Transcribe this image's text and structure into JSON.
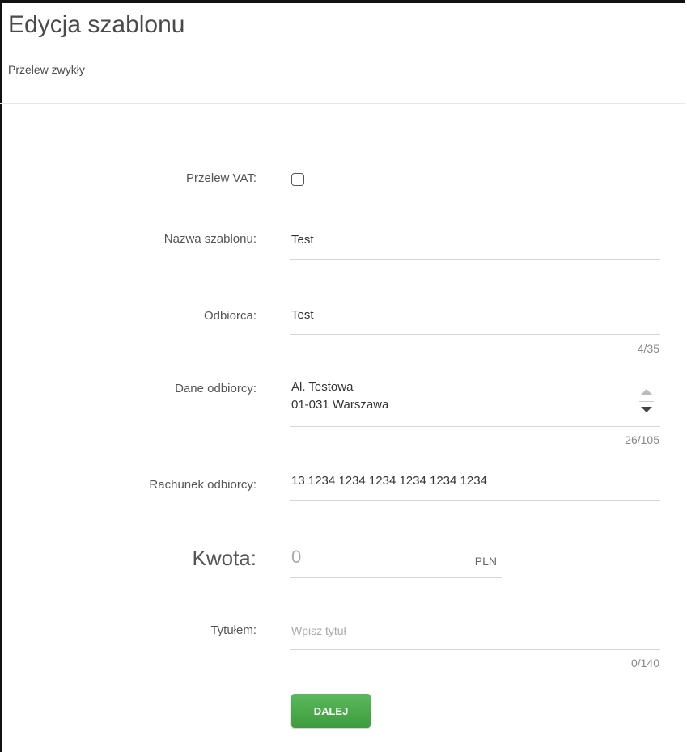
{
  "header": {
    "title": "Edycja szablonu",
    "subtitle": "Przelew zwykły"
  },
  "form": {
    "vat": {
      "label": "Przelew VAT:",
      "checked": false
    },
    "template_name": {
      "label": "Nazwa szablonu:",
      "value": "Test"
    },
    "recipient": {
      "label": "Odbiorca:",
      "value": "Test",
      "counter": "4/35"
    },
    "recipient_details": {
      "label": "Dane odbiorcy:",
      "line1": "Al. Testowa",
      "line2": "01-031 Warszawa",
      "counter": "26/105"
    },
    "account": {
      "label": "Rachunek odbiorcy:",
      "value": "13 1234 1234 1234 1234 1234 1234"
    },
    "amount": {
      "label": "Kwota:",
      "value": "0",
      "currency": "PLN"
    },
    "title": {
      "label": "Tytułem:",
      "placeholder": "Wpisz tytuł",
      "counter": "0/140"
    },
    "submit_label": "DALEJ"
  },
  "colors": {
    "button": "#4cae4c",
    "divider": "#d6d6d6"
  }
}
